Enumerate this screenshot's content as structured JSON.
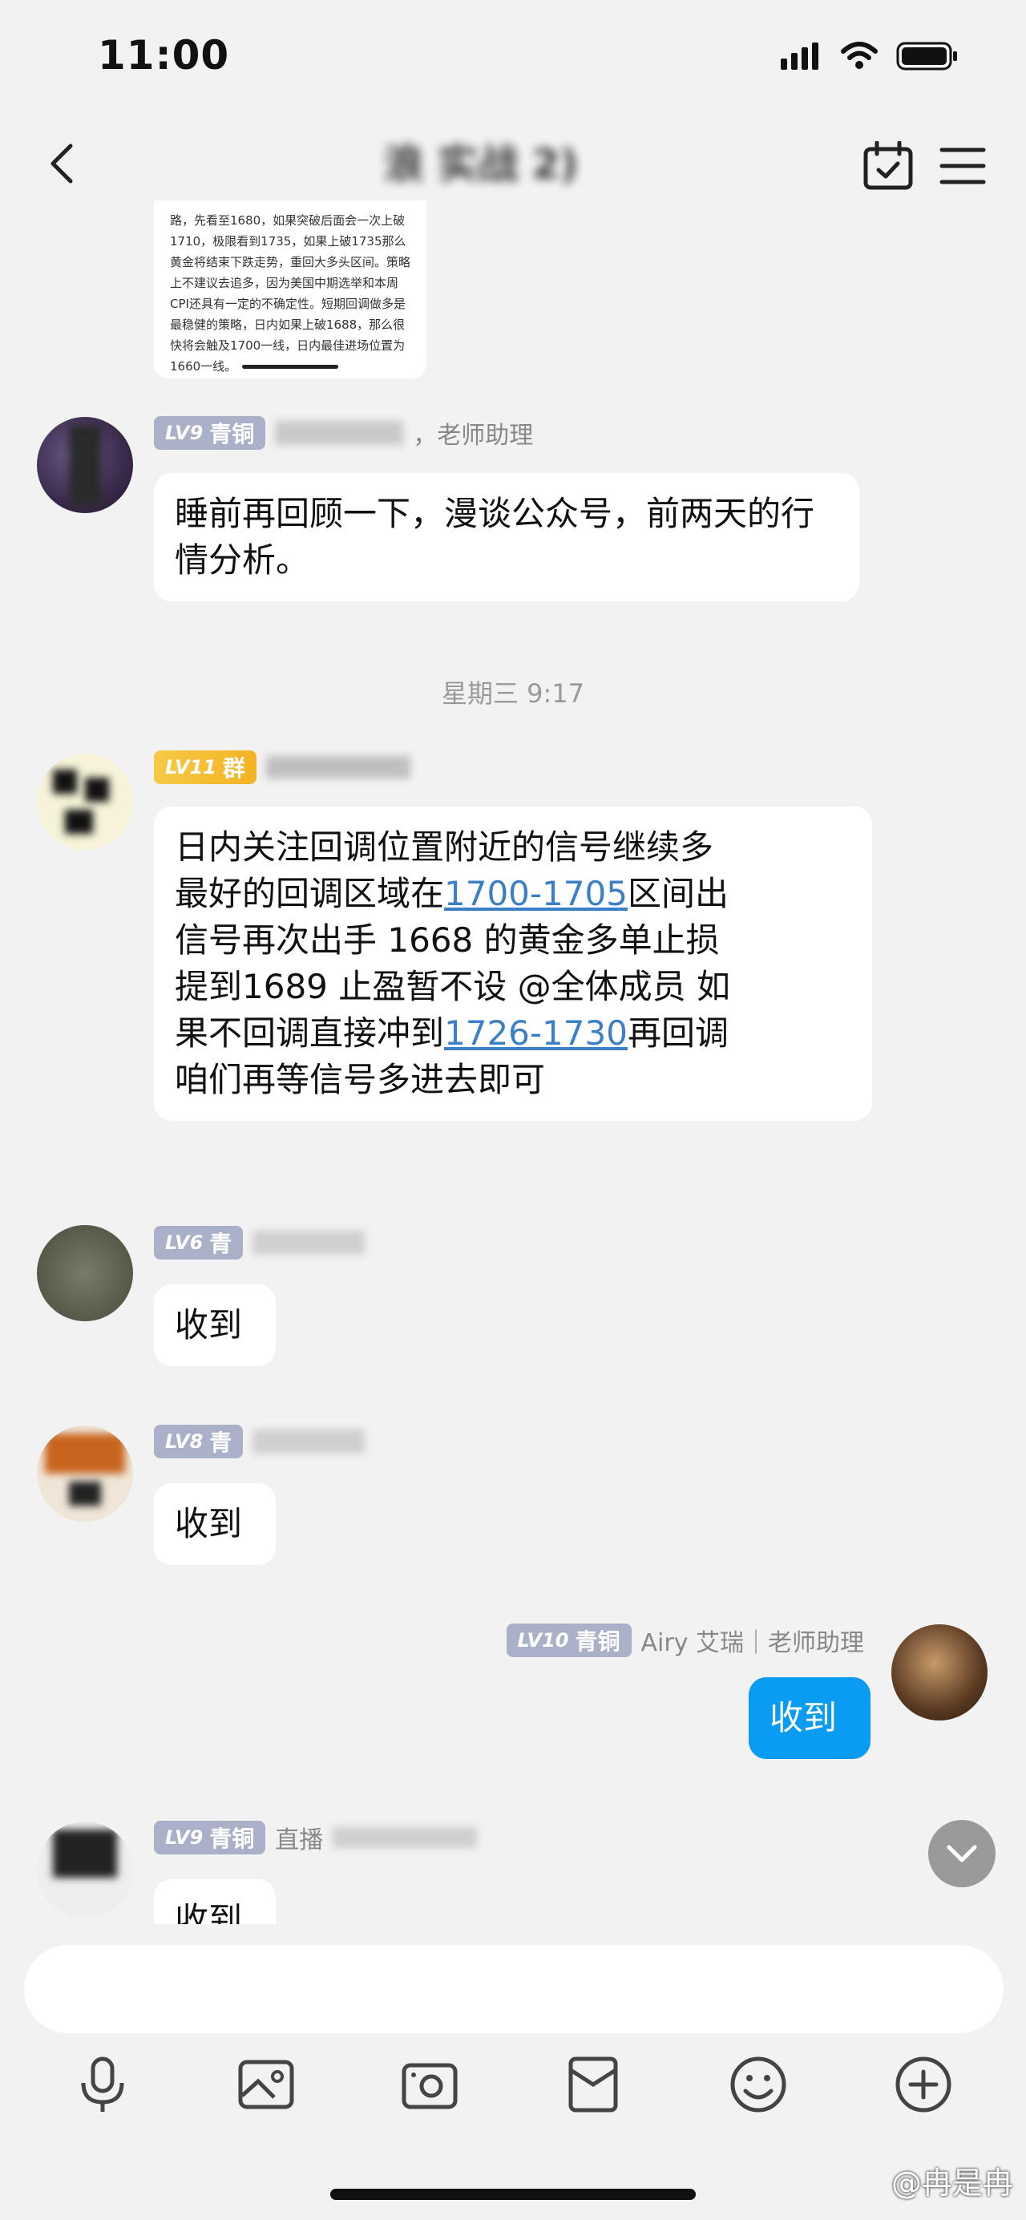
{
  "status_bar": {
    "time": "11:00"
  },
  "header": {
    "title": "浪 实战 2)"
  },
  "preview_image": {
    "text": "路，先看至1680，如果突破后面会一次上破1710，极限看到1735，如果上破1735那么黄金将结束下跌走势，重回大多头区间。策略上不建议去追多，因为美国中期选举和本周CPI还具有一定的不确定性。短期回调做多是最稳健的策略，日内如果上破1688，那么很快将会触及1700一线，日内最佳进场位置为1660一线。"
  },
  "messages": [
    {
      "badge_level": "LV9",
      "badge_title": "青铜",
      "sender": "，老师助理",
      "text": "睡前再回顾一下，漫谈公众号，前两天的行情分析。"
    },
    {
      "timestamp": "星期三 9:17"
    },
    {
      "badge_level": "LV11",
      "badge_title": "群",
      "sender": "",
      "line1": "日内关注回调位置附近的信号继续多",
      "line2a": "最好的回调区域在",
      "link1": "1700-1705",
      "line2b": "区间出",
      "line3": "信号再次出手 1668 的黄金多单止损",
      "line4": "提到1689 止盈暂不设 @全体成员  如",
      "line5a": "果不回调直接冲到",
      "link2": "1726-1730",
      "line5b": "再回调",
      "line6": "咱们再等信号多进去即可"
    },
    {
      "badge_level": "LV6",
      "badge_title": "青",
      "sender": "",
      "text": "收到"
    },
    {
      "badge_level": "LV8",
      "badge_title": "青",
      "sender": "",
      "text": "收到"
    },
    {
      "badge_level": "LV10",
      "badge_title": "青铜",
      "sender": "Airy 艾瑞｜老师助理",
      "text": "收到",
      "mine": true
    },
    {
      "badge_level": "LV9",
      "badge_title": "青铜",
      "sender": "直播",
      "text": "收到"
    }
  ],
  "input": {
    "placeholder": ""
  },
  "toolbar": {
    "icons": [
      "microphone-icon",
      "image-icon",
      "camera-icon",
      "red-packet-icon",
      "emoji-icon",
      "plus-icon"
    ]
  },
  "watermark": "@冉是冉"
}
